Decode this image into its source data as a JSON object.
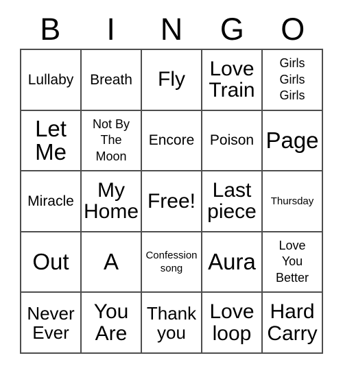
{
  "card": {
    "title": "BINGO",
    "header_letters": [
      "B",
      "I",
      "N",
      "G",
      "O"
    ],
    "free_space_label": "Free!",
    "colors": {
      "background": "#ffffff",
      "text": "#000000",
      "grid_line": "#4d4d4d"
    },
    "rows": [
      [
        {
          "label": "Lullaby",
          "size": "m"
        },
        {
          "label": "Breath",
          "size": "m"
        },
        {
          "label": "Fly",
          "size": "xl"
        },
        {
          "label": "Love\nTrain",
          "size": "xl"
        },
        {
          "label": "Girls\nGirls\nGirls",
          "size": "s"
        }
      ],
      [
        {
          "label": "Let\nMe",
          "size": "xxl"
        },
        {
          "label": "Not By\nThe\nMoon",
          "size": "s"
        },
        {
          "label": "Encore",
          "size": "m"
        },
        {
          "label": "Poison",
          "size": "m"
        },
        {
          "label": "Page",
          "size": "xxl"
        }
      ],
      [
        {
          "label": "Miracle",
          "size": "m"
        },
        {
          "label": "My\nHome",
          "size": "xl"
        },
        {
          "label": "Free!",
          "size": "xl"
        },
        {
          "label": "Last\npiece",
          "size": "xl"
        },
        {
          "label": "Thursday",
          "size": "xs"
        }
      ],
      [
        {
          "label": "Out",
          "size": "xxl"
        },
        {
          "label": "A",
          "size": "xxl"
        },
        {
          "label": "Confession\nsong",
          "size": "xs"
        },
        {
          "label": "Aura",
          "size": "xxl"
        },
        {
          "label": "Love\nYou\nBetter",
          "size": "s"
        }
      ],
      [
        {
          "label": "Never\nEver",
          "size": "l"
        },
        {
          "label": "You\nAre",
          "size": "xl"
        },
        {
          "label": "Thank\nyou",
          "size": "l"
        },
        {
          "label": "Love\nloop",
          "size": "xl"
        },
        {
          "label": "Hard\nCarry",
          "size": "xl"
        }
      ]
    ]
  }
}
